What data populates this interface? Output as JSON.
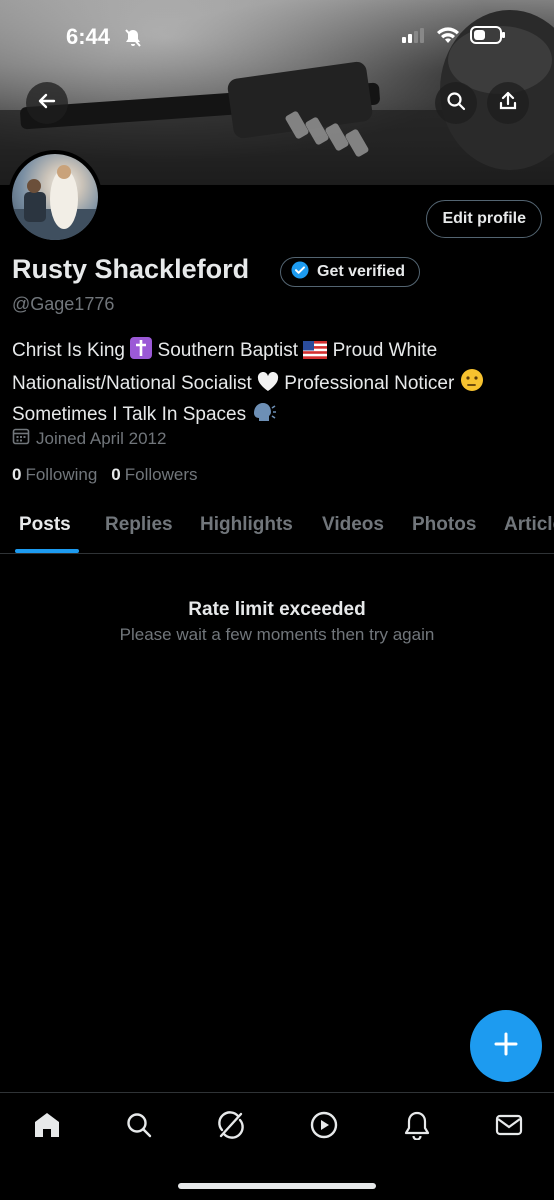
{
  "status_bar": {
    "time": "6:44"
  },
  "profile": {
    "name": "Rusty Shackleford",
    "verify_label": "Get verified",
    "handle": "@Gage1776",
    "edit_label": "Edit profile",
    "bio": {
      "line1_a": "Christ Is King",
      "line1_b": "Southern Baptist",
      "line1_c": "Proud White",
      "line2_a": "Nationalist/National Socialist",
      "line2_b": "Professional Noticer",
      "line3_a": "Sometimes I Talk In Spaces"
    },
    "joined": "Joined April 2012",
    "following_count": "0",
    "following_label": "Following",
    "followers_count": "0",
    "followers_label": "Followers"
  },
  "tabs": [
    "Posts",
    "Replies",
    "Highlights",
    "Videos",
    "Photos",
    "Articles"
  ],
  "active_tab": "Posts",
  "empty_state": {
    "title": "Rate limit exceeded",
    "subtitle": "Please wait a few moments then try again"
  },
  "icons": {
    "back": "arrow-left-icon",
    "search": "search-icon",
    "share": "share-icon",
    "calendar": "calendar-icon",
    "compose": "plus-icon",
    "nav": [
      "home-icon",
      "search-icon",
      "grok-icon",
      "play-icon",
      "bell-icon",
      "mail-icon"
    ]
  },
  "colors": {
    "accent": "#1d9bf0",
    "background": "#000000",
    "muted": "#71767b",
    "border": "#536471"
  }
}
